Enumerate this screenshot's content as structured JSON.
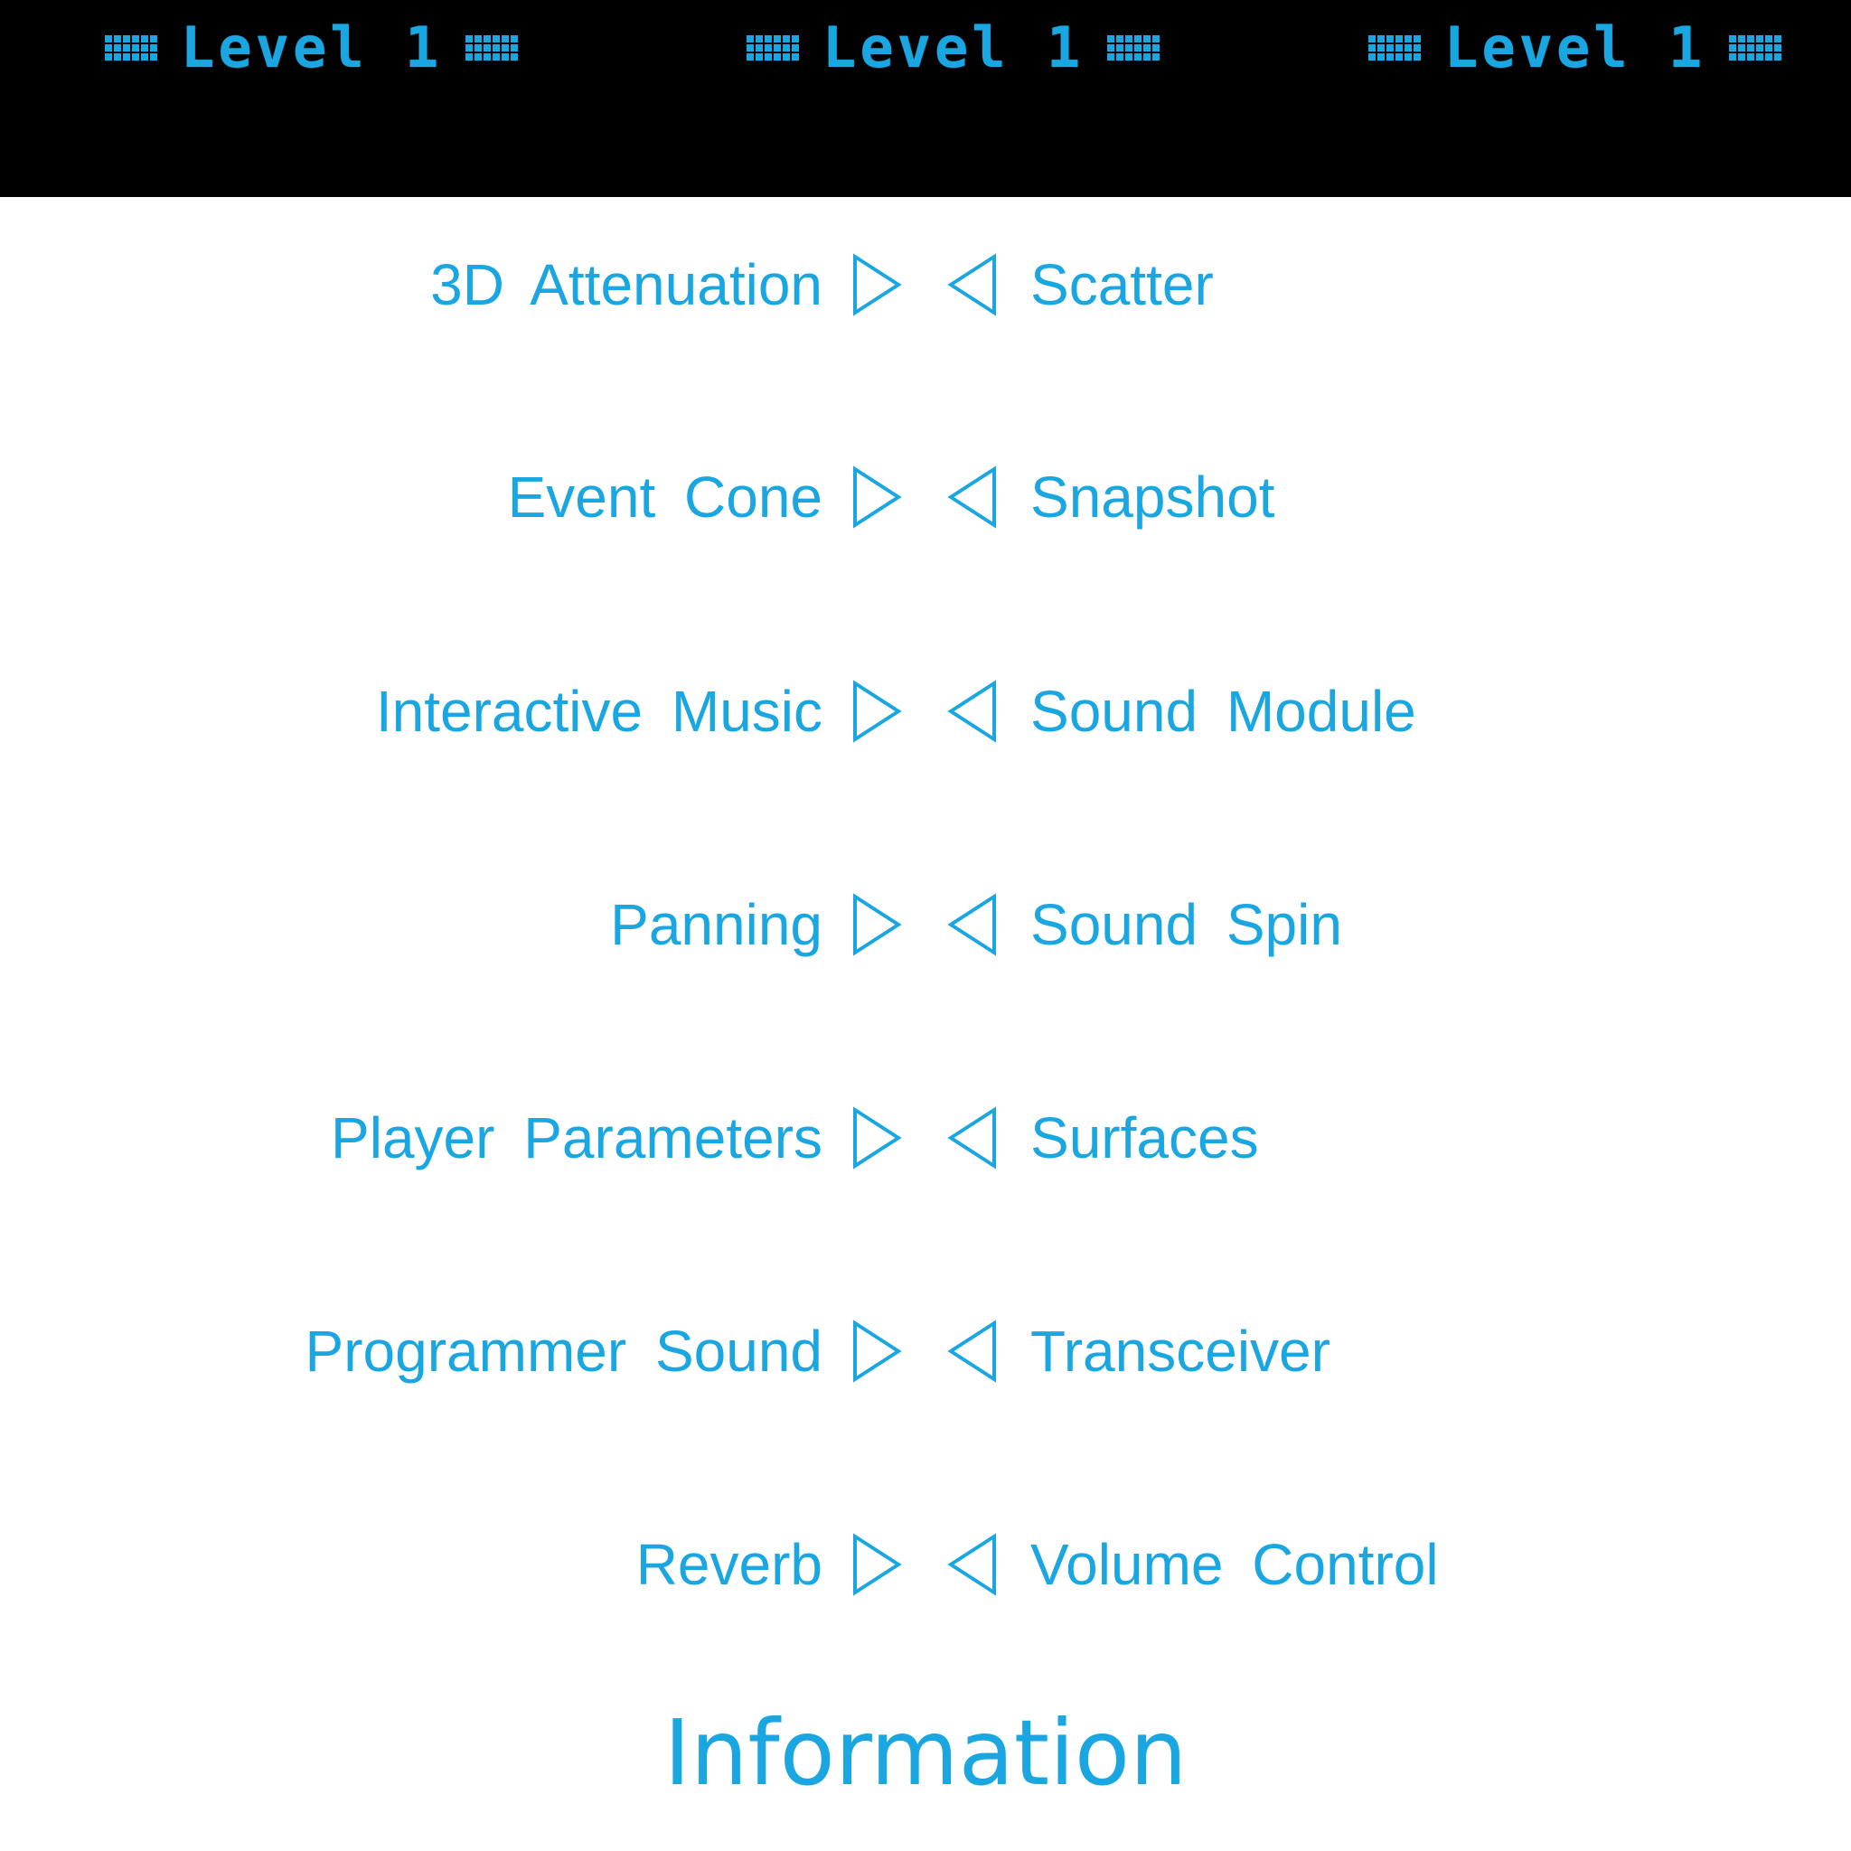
{
  "header": {
    "level_labels": [
      "Level 1",
      "Level 1",
      "Level 1"
    ]
  },
  "menu": {
    "rows": [
      {
        "left": "3D Attenuation",
        "right": "Scatter"
      },
      {
        "left": "Event Cone",
        "right": "Snapshot"
      },
      {
        "left": "Interactive Music",
        "right": "Sound Module"
      },
      {
        "left": "Panning",
        "right": "Sound Spin"
      },
      {
        "left": "Player Parameters",
        "right": "Surfaces"
      },
      {
        "left": "Programmer Sound",
        "right": "Transceiver"
      },
      {
        "left": "Reverb",
        "right": "Volume Control"
      }
    ]
  },
  "footer": {
    "title": "Information"
  },
  "icons": {
    "next": "triangle-right-icon",
    "prev": "triangle-left-icon",
    "dots": "dot-matrix-icon"
  },
  "colors": {
    "accent": "#1aa6e0",
    "header_bg": "#000000",
    "page_bg": "#ffffff"
  }
}
